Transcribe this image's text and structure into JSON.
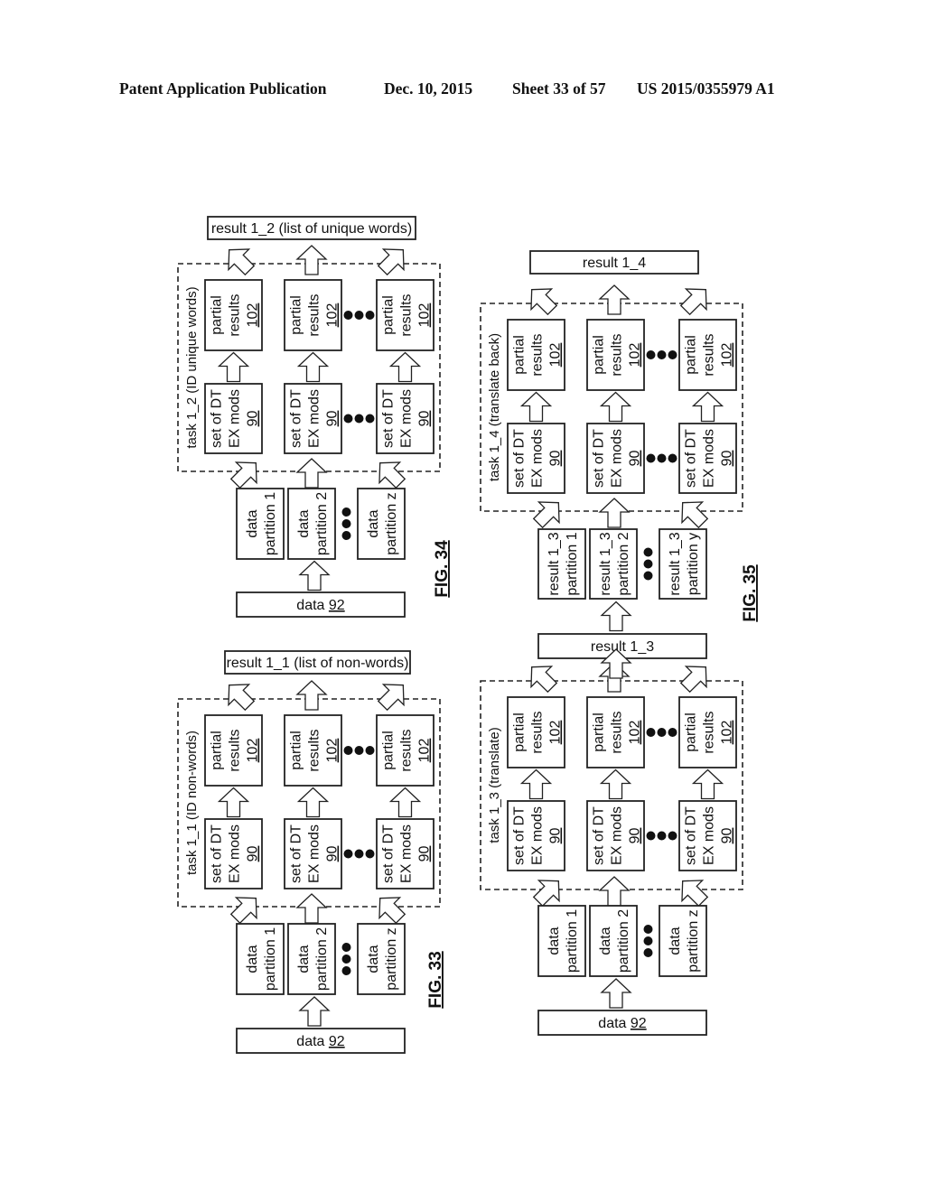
{
  "header": {
    "title": "Patent Application Publication",
    "date": "Dec. 10, 2015",
    "sheet": "Sheet 33 of 57",
    "publication_number": "US 2015/0355979 A1"
  },
  "figures": [
    {
      "id": "fig34",
      "label": "FIG. 34",
      "result_label": "result 1_2 (list of unique words)",
      "task_label": "task 1_2 (ID unique words)",
      "module_lines": [
        "set of DT",
        "EX mods"
      ],
      "module_ref": "90",
      "partial_lines": [
        "partial",
        "results"
      ],
      "partial_ref": "102",
      "partitions": [
        {
          "lines": [
            "data",
            "partition 1"
          ]
        },
        {
          "lines": [
            "data",
            "partition 2"
          ]
        },
        {
          "lines": [
            "data",
            "partition z"
          ]
        }
      ],
      "source_text": "data ",
      "source_ref": "92"
    },
    {
      "id": "fig33",
      "label": "FIG. 33",
      "result_label": "result 1_1 (list of non-words)",
      "task_label": "task 1_1 (ID non-words)",
      "module_lines": [
        "set of DT",
        "EX mods"
      ],
      "module_ref": "90",
      "partial_lines": [
        "partial",
        "results"
      ],
      "partial_ref": "102",
      "partitions": [
        {
          "lines": [
            "data",
            "partition 1"
          ]
        },
        {
          "lines": [
            "data",
            "partition 2"
          ]
        },
        {
          "lines": [
            "data",
            "partition z"
          ]
        }
      ],
      "source_text": "data ",
      "source_ref": "92"
    },
    {
      "id": "fig35a",
      "label": "FIG. 35",
      "result_label": "result 1_4",
      "task_label": "task 1_4 (translate back)",
      "module_lines": [
        "set of DT",
        "EX mods"
      ],
      "module_ref": "90",
      "partial_lines": [
        "partial",
        "results"
      ],
      "partial_ref": "102",
      "partitions": [
        {
          "lines": [
            "result 1_3",
            "partition 1"
          ]
        },
        {
          "lines": [
            "result 1_3",
            "partition 2"
          ]
        },
        {
          "lines": [
            "result 1_3",
            "partition y"
          ]
        }
      ],
      "source_text": "result 1_3",
      "source_ref": ""
    },
    {
      "id": "fig35b",
      "label": "",
      "result_label": "",
      "task_label": "task 1_3 (translate)",
      "module_lines": [
        "set of DT",
        "EX mods"
      ],
      "module_ref": "90",
      "partial_lines": [
        "partial",
        "results"
      ],
      "partial_ref": "102",
      "partitions": [
        {
          "lines": [
            "data",
            "partition 1"
          ]
        },
        {
          "lines": [
            "data",
            "partition 2"
          ]
        },
        {
          "lines": [
            "data",
            "partition z"
          ]
        }
      ],
      "source_text": "data ",
      "source_ref": "92"
    }
  ]
}
